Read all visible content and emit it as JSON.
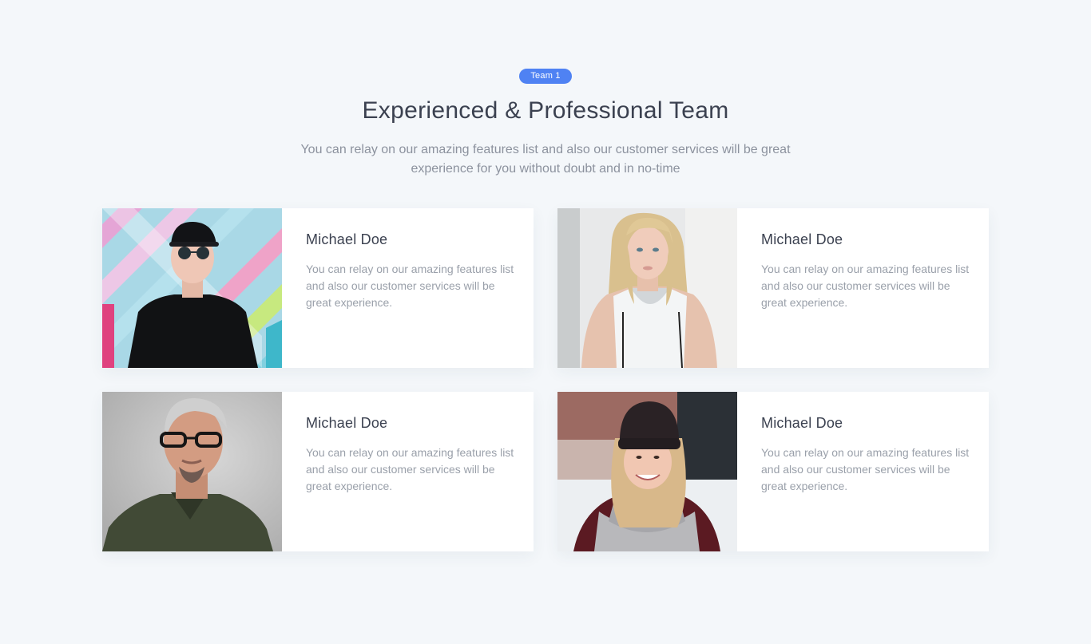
{
  "section": {
    "badge": "Team 1",
    "title": "Experienced & Professional Team",
    "subtitle": "You can relay on our amazing features list and also our customer services will be great experience for you without doubt and in no-time"
  },
  "members": [
    {
      "name": "Michael Doe",
      "description": "You can relay on our amazing features list and also our customer services will be great experience."
    },
    {
      "name": "Michael Doe",
      "description": "You can relay on our amazing features list and also our customer services will be great experience."
    },
    {
      "name": "Michael Doe",
      "description": "You can relay on our amazing features list and also our customer services will be great experience."
    },
    {
      "name": "Michael Doe",
      "description": "You can relay on our amazing features list and also our customer services will be great experience."
    }
  ],
  "colors": {
    "background": "#f4f7fa",
    "accent": "#4f82f3",
    "heading": "#3b4150",
    "muted": "#8c929e"
  }
}
